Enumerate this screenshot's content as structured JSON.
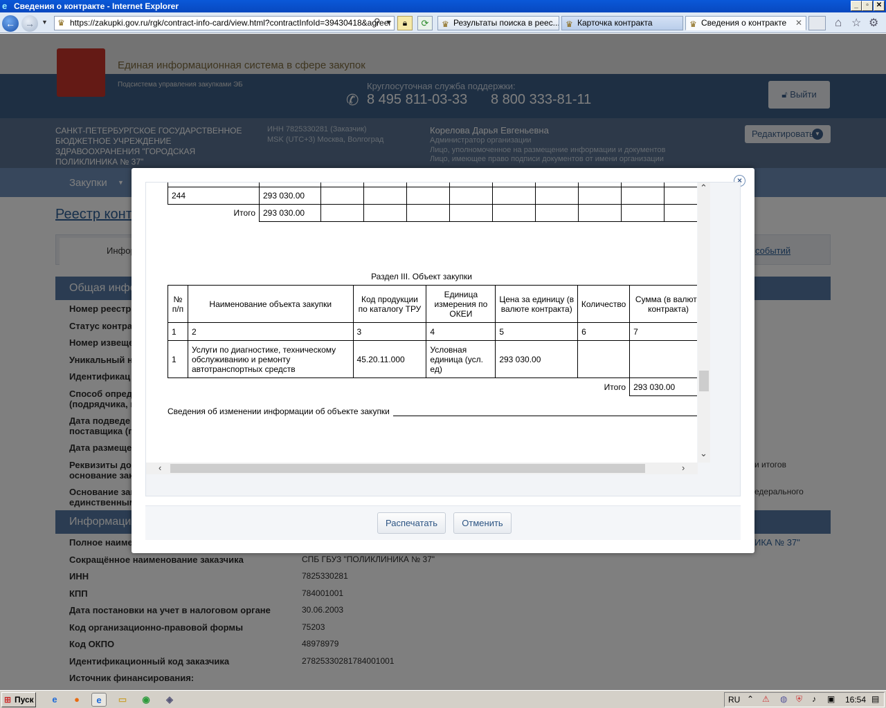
{
  "browser": {
    "window_title": "Сведения о контракте - Internet Explorer",
    "url": "https://zakupki.gov.ru/rgk/contract-info-card/view.html?contractInfoId=39430418&agreer",
    "tabs": [
      {
        "label": "Результаты поиска в реес...",
        "active": false
      },
      {
        "label": "Карточка контракта",
        "active": false
      },
      {
        "label": "Сведения о контракте",
        "active": true
      }
    ]
  },
  "header": {
    "system_title": "Единая информационная система в сфере закупок",
    "subsystem": "Подсистема управления закупками ЭБ",
    "support_label": "Круглосуточная служба поддержки:",
    "phone1": "8 495 811-03-33",
    "phone2": "8 800 333-81-11",
    "logout": "Выйти",
    "org_name": "САНКТ-ПЕТЕРБУРГСКОЕ ГОСУДАРСТВЕННОЕ БЮДЖЕТНОЕ УЧРЕЖДЕНИЕ ЗДРАВООХРАНЕНИЯ \"ГОРОДСКАЯ ПОЛИКЛИНИКА № 37\"",
    "inn_line": "ИНН 7825330281 (Заказчик)",
    "tz_line": "MSK (UTC+3) Москва, Волгоград",
    "user_name": "Корелова Дарья Евгеньевна",
    "user_roles": [
      "Администратор организации",
      "Лицо, уполномоченное на размещение информации и документов",
      "Лицо, имеющее право подписи документов от имени организации"
    ],
    "edit_button": "Редактировать",
    "menu_item": "Закупки"
  },
  "background_page": {
    "page_title": "Реестр контр",
    "tab_left": "Инфор",
    "tab_right": "событий",
    "section1": "Общая инфор",
    "rows1": [
      "Номер реестро",
      "Статус контра",
      "Номер извеще",
      "Уникальный н",
      "Идентификац",
      "Способ опреде (подрядчика, и",
      "Дата подведе поставщика (п",
      "Дата размеще",
      "Реквизиты до основание зак",
      "Основание зак единственным"
    ],
    "right_frag1": "и итогов",
    "right_frag2": "едерального",
    "section2": "Информация о",
    "right_frag3": "ИКА № 37\"",
    "details": [
      {
        "label": "Полное наиме",
        "value": ""
      },
      {
        "label": "Сокращённое наименование заказчика",
        "value": "СПБ ГБУЗ \"ПОЛИКЛИНИКА № 37\""
      },
      {
        "label": "ИНН",
        "value": "7825330281"
      },
      {
        "label": "КПП",
        "value": "784001001"
      },
      {
        "label": "Дата постановки на учет в налоговом органе",
        "value": "30.06.2003"
      },
      {
        "label": "Код организационно-правовой формы",
        "value": "75203"
      },
      {
        "label": "Код ОКПО",
        "value": "48978979"
      },
      {
        "label": "Идентификационный код заказчика",
        "value": "27825330281784001001"
      },
      {
        "label": "Источник финансирования:",
        "value": ""
      }
    ]
  },
  "modal": {
    "top_table": {
      "row1_code": "244",
      "row1_sum": "293 030.00",
      "total_label": "Итого",
      "total_sum": "293 030.00"
    },
    "section_title": "Раздел III. Объект закупки",
    "object_table": {
      "headers": [
        "№ п/п",
        "Наименование объекта закупки",
        "Код продукции по каталогу ТРУ",
        "Единица измерения по ОКЕИ",
        "Цена за единицу (в валюте контракта)",
        "Количество",
        "Сумма (в валюте контракта)"
      ],
      "numbering": [
        "1",
        "2",
        "3",
        "4",
        "5",
        "6",
        "7"
      ],
      "rows": [
        {
          "n": "1",
          "name": "Услуги по диагностике, техническому обслуживанию и ремонту автотранспортных средств",
          "code": "45.20.11.000",
          "unit": "Условная единица (усл. ед)",
          "price": "293 030.00",
          "qty": "",
          "sum": ""
        }
      ],
      "total_label": "Итого",
      "total_sum": "293 030.00"
    },
    "changes_label": "Сведения об изменении информации об объекте закупки",
    "print_button": "Распечатать",
    "cancel_button": "Отменить"
  },
  "taskbar": {
    "start": "Пуск",
    "lang": "RU",
    "clock": "16:54"
  }
}
